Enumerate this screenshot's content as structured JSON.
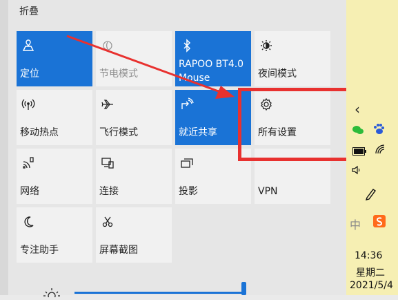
{
  "header": {
    "collapse_label": "折叠"
  },
  "tiles": [
    {
      "label": "定位",
      "icon": "location-icon",
      "state": "active"
    },
    {
      "label": "节电模式",
      "icon": "battery-saver-icon",
      "state": "disabled"
    },
    {
      "label": "RAPOO BT4.0",
      "label2": "Mouse",
      "icon": "bluetooth-icon",
      "state": "active"
    },
    {
      "label": "夜间模式",
      "icon": "night-light-icon",
      "state": "normal"
    },
    {
      "label": "移动热点",
      "icon": "mobile-hotspot-icon",
      "state": "normal"
    },
    {
      "label": "飞行模式",
      "icon": "airplane-icon",
      "state": "normal"
    },
    {
      "label": "就近共享",
      "icon": "nearby-share-icon",
      "state": "active"
    },
    {
      "label": "所有设置",
      "icon": "gear-icon",
      "state": "normal"
    },
    {
      "label": "网络",
      "icon": "network-icon",
      "state": "normal"
    },
    {
      "label": "连接",
      "icon": "connect-icon",
      "state": "normal"
    },
    {
      "label": "投影",
      "icon": "project-icon",
      "state": "normal"
    },
    {
      "label": "VPN",
      "icon": "vpn-icon",
      "state": "normal"
    },
    {
      "label": "专注助手",
      "icon": "focus-assist-icon",
      "state": "normal"
    },
    {
      "label": "屏幕截图",
      "icon": "screen-snip-icon",
      "state": "normal"
    }
  ],
  "tray": {
    "time": "14:36",
    "weekday": "星期二",
    "date": "2021/5/4",
    "ime_label": "中"
  },
  "colors": {
    "accent": "#1a73d6",
    "annotation": "#e8312f",
    "taskbar": "#f6efb3"
  }
}
